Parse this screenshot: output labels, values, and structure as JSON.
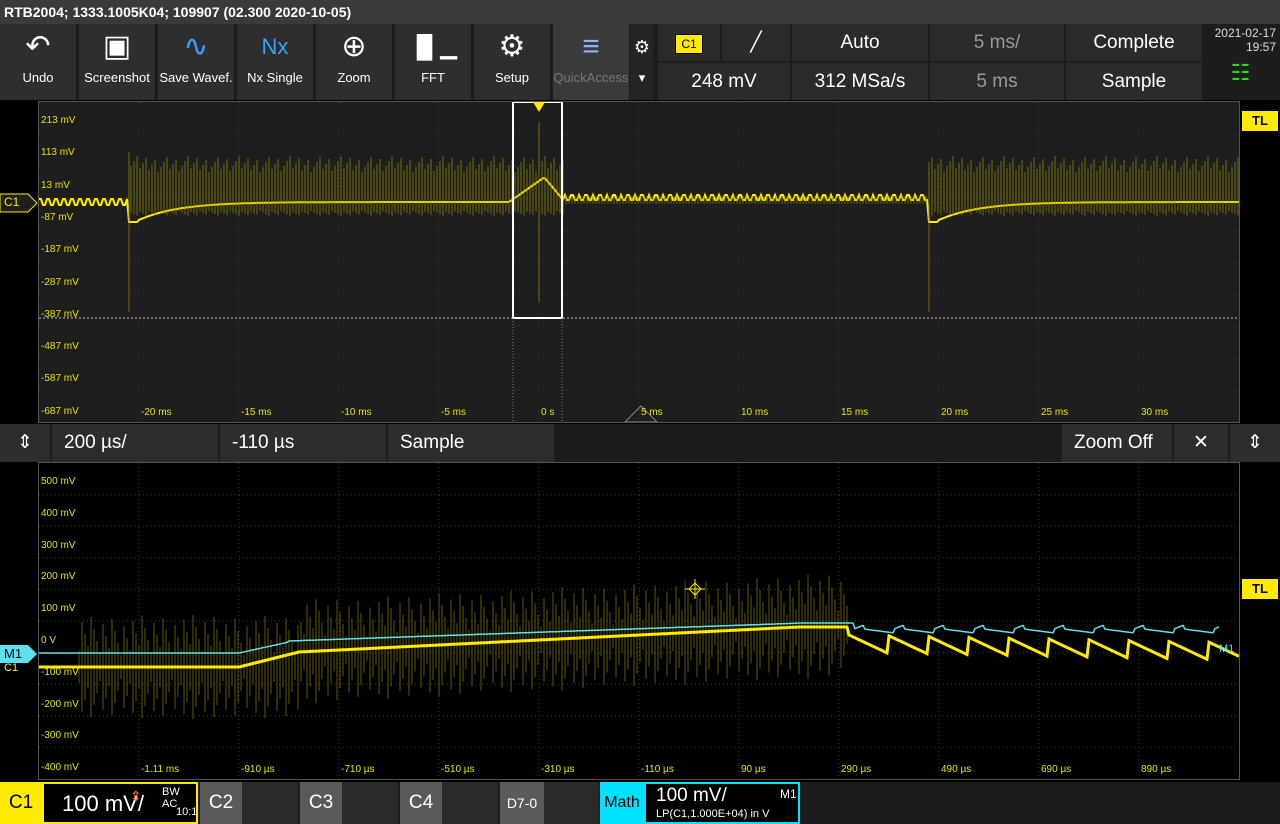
{
  "titlebar": "RTB2004; 1333.1005K04; 109907 (02.300 2020-10-05)",
  "toolbar": [
    {
      "label": "Undo",
      "icon": "undo-icon"
    },
    {
      "label": "Screenshot",
      "icon": "camera-icon"
    },
    {
      "label": "Save Wavef.",
      "icon": "save-waveform-icon"
    },
    {
      "label": "Nx Single",
      "icon": "nx-single-icon"
    },
    {
      "label": "Zoom",
      "icon": "zoom-icon"
    },
    {
      "label": "FFT",
      "icon": "fft-icon"
    },
    {
      "label": "Setup",
      "icon": "gear-icon"
    },
    {
      "label": "QuickAccess",
      "icon": "quick-access-icon"
    }
  ],
  "trigger": {
    "source": "C1",
    "slope_icon": "rising-edge-icon",
    "mode": "Auto",
    "timebase": "5 ms/",
    "acq_state": "Complete",
    "level": "248 mV",
    "sample_rate": "312 MSa/s",
    "position": "5 ms",
    "acq_mode": "Sample"
  },
  "datetime": {
    "date": "2021-02-17",
    "time": "19:57"
  },
  "colors": {
    "ch1": "#ffea00",
    "math": "#5fe0f0",
    "accent": "#00e0ff"
  },
  "upper": {
    "y_ticks": [
      "213 mV",
      "113 mV",
      "13 mV",
      "-87 mV",
      "-187 mV",
      "-287 mV",
      "-387 mV",
      "-487 mV",
      "-587 mV",
      "-687 mV"
    ],
    "x_ticks": [
      "-20 ms",
      "-15 ms",
      "-10 ms",
      "-5 ms",
      "0 s",
      "5 ms",
      "10 ms",
      "15 ms",
      "20 ms",
      "25 ms",
      "30 ms"
    ],
    "ch_label": "C1",
    "tl_label": "TL"
  },
  "zoom": {
    "scale": "200 µs/",
    "offset": "-110 µs",
    "mode": "Sample",
    "off_label": "Zoom Off",
    "close": "✕"
  },
  "lower": {
    "y_ticks": [
      "500 mV",
      "400 mV",
      "300 mV",
      "200 mV",
      "100 mV",
      "0 V",
      "-100 mV",
      "-200 mV",
      "-300 mV",
      "-400 mV"
    ],
    "x_ticks": [
      "-1.11 ms",
      "-910 µs",
      "-710 µs",
      "-510 µs",
      "-310 µs",
      "-110 µs",
      "90 µs",
      "290 µs",
      "490 µs",
      "690 µs",
      "890 µs"
    ],
    "m1_label": "M1",
    "c1_label": "C1",
    "tl_label": "TL",
    "m1_trace_label": "M1"
  },
  "bottom": {
    "c1": "C1",
    "c1_scale": "100 mV/",
    "c1_bw": "BW AC",
    "c1_probe": "10:1",
    "c2": "C2",
    "c3": "C3",
    "c4": "C4",
    "d70": "D7-0",
    "math": "Math",
    "math_scale": "100 mV/",
    "math_name": "M1",
    "math_expr": "LP(C1,1.000E+04) in V"
  }
}
